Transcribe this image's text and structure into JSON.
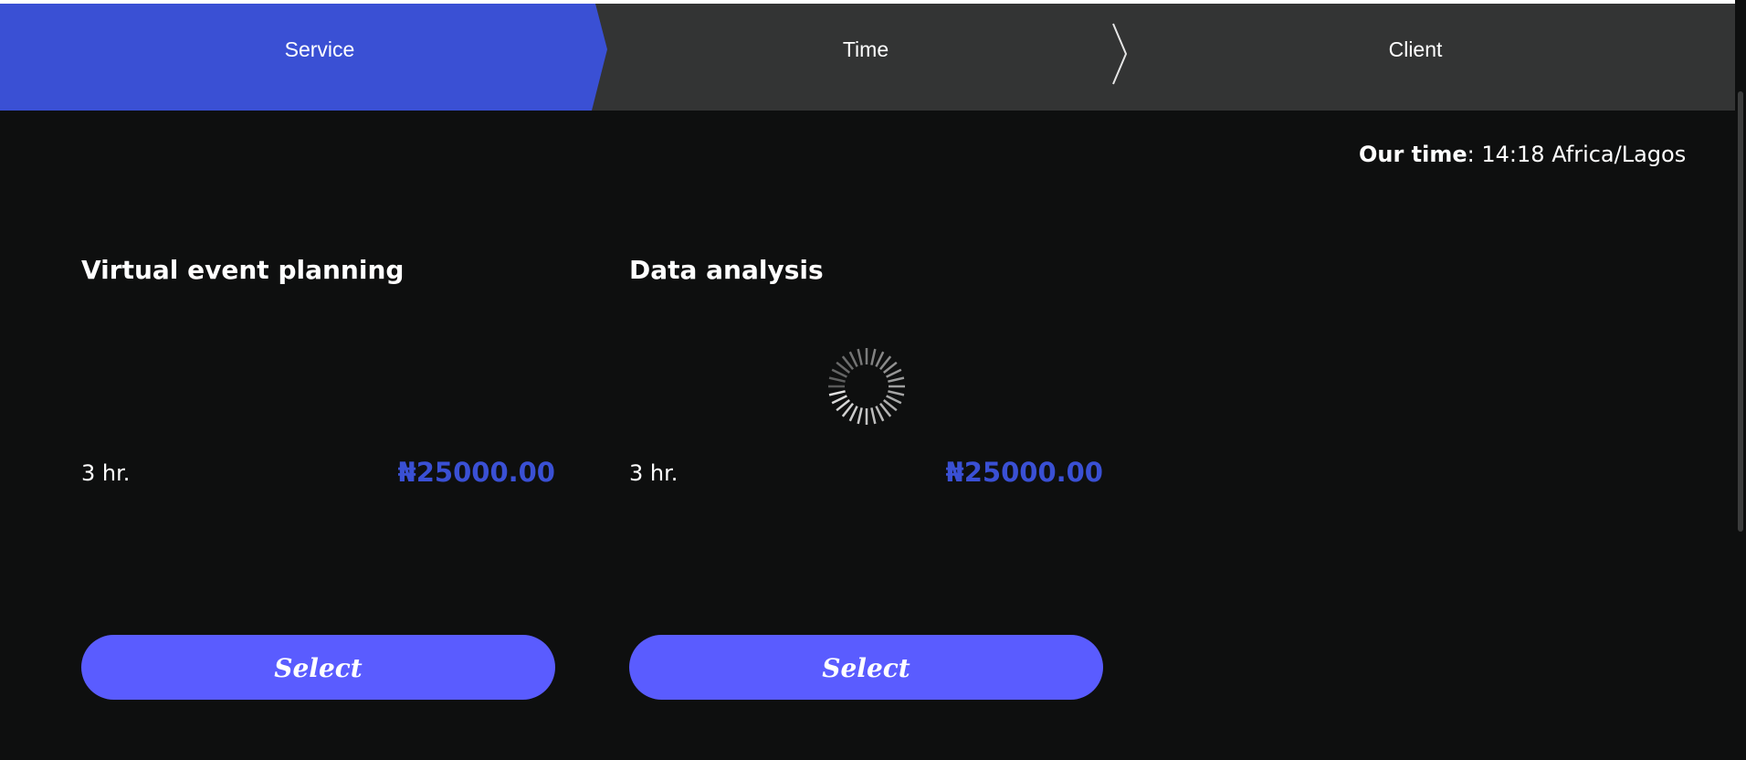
{
  "steps": [
    {
      "label": "Service",
      "active": true
    },
    {
      "label": "Time",
      "active": false
    },
    {
      "label": "Client",
      "active": false
    }
  ],
  "our_time": {
    "label": "Our time",
    "separator": ":",
    "value": " 14:18 Africa/Lagos"
  },
  "services": [
    {
      "title": "Virtual event planning",
      "duration": "3 hr.",
      "price": "₦25000.00",
      "button_label": "Select"
    },
    {
      "title": "Data analysis",
      "duration": "3 hr.",
      "price": "₦25000.00",
      "button_label": "Select"
    }
  ],
  "loading": {
    "icon": "spinner-icon"
  },
  "colors": {
    "accent": "#3a50d4",
    "button": "#5a5cff",
    "background": "#0e0f0f",
    "steps_bg": "#333434",
    "text": "#ffffff"
  }
}
